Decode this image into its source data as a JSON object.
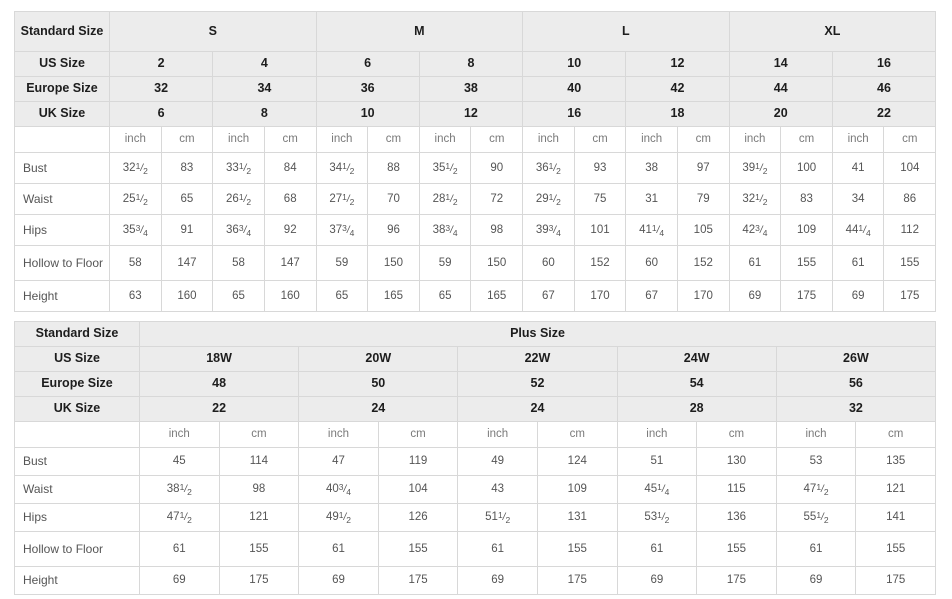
{
  "standard_table": {
    "label_column_header": "Standard Size",
    "size_groups": [
      {
        "label": "S",
        "span": 4
      },
      {
        "label": "M",
        "span": 4
      },
      {
        "label": "L",
        "span": 4
      },
      {
        "label": "XL",
        "span": 4
      }
    ],
    "rows": [
      {
        "label": "US Size",
        "values": [
          "2",
          "4",
          "6",
          "8",
          "10",
          "12",
          "14",
          "16"
        ]
      },
      {
        "label": "Europe Size",
        "values": [
          "32",
          "34",
          "36",
          "38",
          "40",
          "42",
          "44",
          "46"
        ]
      },
      {
        "label": "UK Size",
        "values": [
          "6",
          "8",
          "10",
          "12",
          "16",
          "18",
          "20",
          "22"
        ]
      }
    ],
    "unit_row": {
      "label": "",
      "units": [
        "inch",
        "cm",
        "inch",
        "cm",
        "inch",
        "cm",
        "inch",
        "cm",
        "inch",
        "cm",
        "inch",
        "cm",
        "inch",
        "cm",
        "inch",
        "cm"
      ]
    },
    "measurements": [
      {
        "label": "Bust",
        "cells": [
          {
            "whole": "32",
            "num": "1",
            "den": "2"
          },
          {
            "whole": "83"
          },
          {
            "whole": "33",
            "num": "1",
            "den": "2"
          },
          {
            "whole": "84"
          },
          {
            "whole": "34",
            "num": "1",
            "den": "2"
          },
          {
            "whole": "88"
          },
          {
            "whole": "35",
            "num": "1",
            "den": "2"
          },
          {
            "whole": "90"
          },
          {
            "whole": "36",
            "num": "1",
            "den": "2"
          },
          {
            "whole": "93"
          },
          {
            "whole": "38"
          },
          {
            "whole": "97"
          },
          {
            "whole": "39",
            "num": "1",
            "den": "2"
          },
          {
            "whole": "100"
          },
          {
            "whole": "41"
          },
          {
            "whole": "104"
          }
        ]
      },
      {
        "label": "Waist",
        "cells": [
          {
            "whole": "25",
            "num": "1",
            "den": "2"
          },
          {
            "whole": "65"
          },
          {
            "whole": "26",
            "num": "1",
            "den": "2"
          },
          {
            "whole": "68"
          },
          {
            "whole": "27",
            "num": "1",
            "den": "2"
          },
          {
            "whole": "70"
          },
          {
            "whole": "28",
            "num": "1",
            "den": "2"
          },
          {
            "whole": "72"
          },
          {
            "whole": "29",
            "num": "1",
            "den": "2"
          },
          {
            "whole": "75"
          },
          {
            "whole": "31"
          },
          {
            "whole": "79"
          },
          {
            "whole": "32",
            "num": "1",
            "den": "2"
          },
          {
            "whole": "83"
          },
          {
            "whole": "34"
          },
          {
            "whole": "86"
          }
        ]
      },
      {
        "label": "Hips",
        "cells": [
          {
            "whole": "35",
            "num": "3",
            "den": "4"
          },
          {
            "whole": "91"
          },
          {
            "whole": "36",
            "num": "3",
            "den": "4"
          },
          {
            "whole": "92"
          },
          {
            "whole": "37",
            "num": "3",
            "den": "4"
          },
          {
            "whole": "96"
          },
          {
            "whole": "38",
            "num": "3",
            "den": "4"
          },
          {
            "whole": "98"
          },
          {
            "whole": "39",
            "num": "3",
            "den": "4"
          },
          {
            "whole": "101"
          },
          {
            "whole": "41",
            "num": "1",
            "den": "4"
          },
          {
            "whole": "105"
          },
          {
            "whole": "42",
            "num": "3",
            "den": "4"
          },
          {
            "whole": "109"
          },
          {
            "whole": "44",
            "num": "1",
            "den": "4"
          },
          {
            "whole": "112"
          }
        ]
      },
      {
        "label": "Hollow to Floor",
        "cells": [
          {
            "whole": "58"
          },
          {
            "whole": "147"
          },
          {
            "whole": "58"
          },
          {
            "whole": "147"
          },
          {
            "whole": "59"
          },
          {
            "whole": "150"
          },
          {
            "whole": "59"
          },
          {
            "whole": "150"
          },
          {
            "whole": "60"
          },
          {
            "whole": "152"
          },
          {
            "whole": "60"
          },
          {
            "whole": "152"
          },
          {
            "whole": "61"
          },
          {
            "whole": "155"
          },
          {
            "whole": "61"
          },
          {
            "whole": "155"
          }
        ]
      },
      {
        "label": "Height",
        "cells": [
          {
            "whole": "63"
          },
          {
            "whole": "160"
          },
          {
            "whole": "65"
          },
          {
            "whole": "160"
          },
          {
            "whole": "65"
          },
          {
            "whole": "165"
          },
          {
            "whole": "65"
          },
          {
            "whole": "165"
          },
          {
            "whole": "67"
          },
          {
            "whole": "170"
          },
          {
            "whole": "67"
          },
          {
            "whole": "170"
          },
          {
            "whole": "69"
          },
          {
            "whole": "175"
          },
          {
            "whole": "69"
          },
          {
            "whole": "175"
          }
        ]
      }
    ]
  },
  "plus_table": {
    "label_column_header": "Standard Size",
    "group_title": "Plus Size",
    "rows": [
      {
        "label": "US Size",
        "values": [
          "18W",
          "20W",
          "22W",
          "24W",
          "26W"
        ]
      },
      {
        "label": "Europe Size",
        "values": [
          "48",
          "50",
          "52",
          "54",
          "56"
        ]
      },
      {
        "label": "UK Size",
        "values": [
          "22",
          "24",
          "24",
          "28",
          "32"
        ]
      }
    ],
    "unit_row": {
      "label": "",
      "units": [
        "inch",
        "cm",
        "inch",
        "cm",
        "inch",
        "cm",
        "inch",
        "cm",
        "inch",
        "cm"
      ]
    },
    "measurements": [
      {
        "label": "Bust",
        "cells": [
          {
            "whole": "45"
          },
          {
            "whole": "114"
          },
          {
            "whole": "47"
          },
          {
            "whole": "119"
          },
          {
            "whole": "49"
          },
          {
            "whole": "124"
          },
          {
            "whole": "51"
          },
          {
            "whole": "130"
          },
          {
            "whole": "53"
          },
          {
            "whole": "135"
          }
        ]
      },
      {
        "label": "Waist",
        "cells": [
          {
            "whole": "38",
            "num": "1",
            "den": "2"
          },
          {
            "whole": "98"
          },
          {
            "whole": "40",
            "num": "3",
            "den": "4"
          },
          {
            "whole": "104"
          },
          {
            "whole": "43"
          },
          {
            "whole": "109"
          },
          {
            "whole": "45",
            "num": "1",
            "den": "4"
          },
          {
            "whole": "115"
          },
          {
            "whole": "47",
            "num": "1",
            "den": "2"
          },
          {
            "whole": "121"
          }
        ]
      },
      {
        "label": "Hips",
        "cells": [
          {
            "whole": "47",
            "num": "1",
            "den": "2"
          },
          {
            "whole": "121"
          },
          {
            "whole": "49",
            "num": "1",
            "den": "2"
          },
          {
            "whole": "126"
          },
          {
            "whole": "51",
            "num": "1",
            "den": "2"
          },
          {
            "whole": "131"
          },
          {
            "whole": "53",
            "num": "1",
            "den": "2"
          },
          {
            "whole": "136"
          },
          {
            "whole": "55",
            "num": "1",
            "den": "2"
          },
          {
            "whole": "141"
          }
        ]
      },
      {
        "label": "Hollow to Floor",
        "cells": [
          {
            "whole": "61"
          },
          {
            "whole": "155"
          },
          {
            "whole": "61"
          },
          {
            "whole": "155"
          },
          {
            "whole": "61"
          },
          {
            "whole": "155"
          },
          {
            "whole": "61"
          },
          {
            "whole": "155"
          },
          {
            "whole": "61"
          },
          {
            "whole": "155"
          }
        ]
      },
      {
        "label": "Height",
        "cells": [
          {
            "whole": "69"
          },
          {
            "whole": "175"
          },
          {
            "whole": "69"
          },
          {
            "whole": "175"
          },
          {
            "whole": "69"
          },
          {
            "whole": "175"
          },
          {
            "whole": "69"
          },
          {
            "whole": "175"
          },
          {
            "whole": "69"
          },
          {
            "whole": "175"
          }
        ]
      }
    ]
  },
  "colors": {
    "header_bg": "#ececec",
    "cell_bg": "#ffffff",
    "border": "#d8d8d8",
    "header_text": "#1d1d1d",
    "cell_text": "#555555"
  }
}
